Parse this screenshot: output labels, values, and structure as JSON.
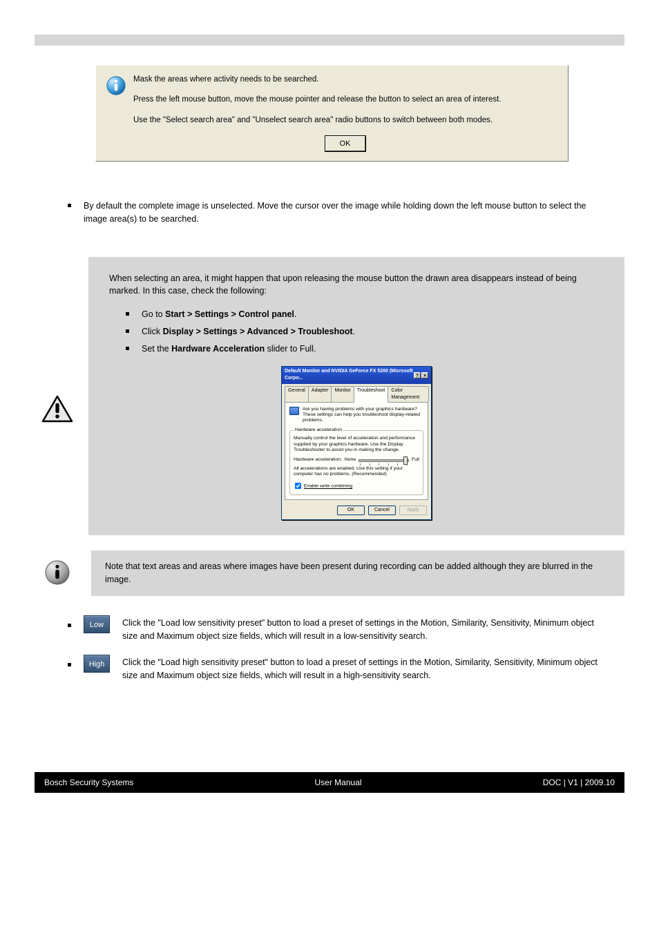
{
  "infoDialog": {
    "line1": "Mask the areas where activity needs to be searched.",
    "line2": "Press the left mouse button, move the mouse pointer and release the button to select an area of interest.",
    "line3": "Use the \"Select search area\" and \"Unselect search area\" radio buttons to switch between both modes.",
    "ok": "OK"
  },
  "bullet1": "By default the complete image is unselected. Move the cursor over the image while holding down the left mouse button to select the image area(s) to be searched.",
  "warningPanel": {
    "intro": "When selecting an area, it might happen that upon releasing the mouse button the drawn area disappears instead of being marked. In this case, check the following:",
    "items": [
      {
        "text_a": "Go to ",
        "bold": "Start > Settings > Control panel",
        "text_b": "."
      },
      {
        "text_a": "Click  ",
        "bold": "Display > Settings > Advanced > Troubleshoot",
        "text_b": "."
      },
      {
        "text_a": "Set the ",
        "bold": "Hardware Acceleration",
        "text_b": " slider to Full."
      }
    ],
    "tsDialog": {
      "title": "Default Monitor and NVIDIA GeForce FX 5200  (Microsoft Corpo...",
      "helpBtn": "?",
      "closeBtn": "×",
      "tabs": [
        "General",
        "Adapter",
        "Monitor",
        "Troubleshoot",
        "Color Management"
      ],
      "activeTab": "Troubleshoot",
      "introText": "Are you having problems with your graphics hardware? These settings can help you troubleshoot display-related problems.",
      "fieldsetLegend": "Hardware acceleration",
      "fsText": "Manually control the level of acceleration and performance supplied by your graphics hardware. Use the Display Troubleshooter to assist you in making the change.",
      "hwLabel": "Hardware acceleration:",
      "none": "None",
      "full": "Full",
      "allAccelText": "All accelerations are enabled. Use this setting if your computer has no problems. (Recommended)",
      "enableWrite": "Enable write combining",
      "ok": "OK",
      "cancel": "Cancel",
      "apply": "Apply"
    }
  },
  "infoNote": "Note that text areas and areas where images have been present during recording can be added although they are blurred in the image.",
  "presets": {
    "low": {
      "chip": "Low",
      "text": "Click the \"Load low sensitivity preset\" button to load a preset of settings in the Motion, Similarity, Sensitivity, Minimum object size and Maximum object size fields, which will result in a low-sensitivity search."
    },
    "high": {
      "chip": "High",
      "text": "Click the \"Load high sensitivity preset\" button to load a preset of settings in the Motion, Similarity, Sensitivity, Minimum object size and Maximum object size fields, which will result in a high-sensitivity search."
    }
  },
  "footer": {
    "left": "Bosch Security Systems",
    "center": "User Manual",
    "right": "DOC | V1 | 2009.10"
  }
}
